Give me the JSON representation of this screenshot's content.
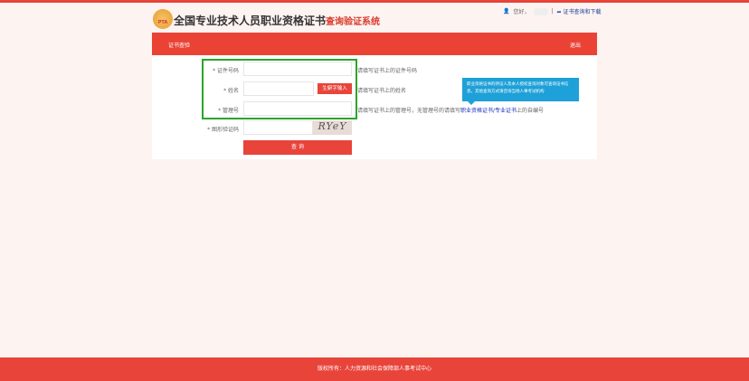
{
  "header": {
    "logo_text": "PTA",
    "title": "全国专业技术人员职业资格证书",
    "title_accent": "查询验证系统",
    "greeting": "您好，",
    "download_link": "证书查询和下载"
  },
  "nav": {
    "tab": "证书查验",
    "logout": "退出"
  },
  "form": {
    "fields": [
      {
        "label": "* 证件号码",
        "hint": "请填写证书上的证件号码"
      },
      {
        "label": "* 姓名",
        "hint": "请填写证书上的姓名"
      },
      {
        "label": "* 管理号",
        "hint_pre": "请填写证书上的管理号，无管理号的请填写",
        "hint_link": "职业资格证书/专业证书",
        "hint_post": "上的自编号"
      },
      {
        "label": "* 图形验证码"
      }
    ],
    "rare_char_button": "生僻字输入",
    "captcha_text": "RYeY",
    "submit": "查 询",
    "tooltip": "职业资格证书的持证人及本人授权查询对象可查询证书信息，其他查询方式请咨询当地人事考试机构"
  },
  "footer": {
    "copyright": "版权所有：人力资源和社会保障部人事考试中心"
  },
  "colors": {
    "brand": "#e8443a",
    "highlight": "#2aa52a",
    "tooltip": "#1ea0d8"
  }
}
